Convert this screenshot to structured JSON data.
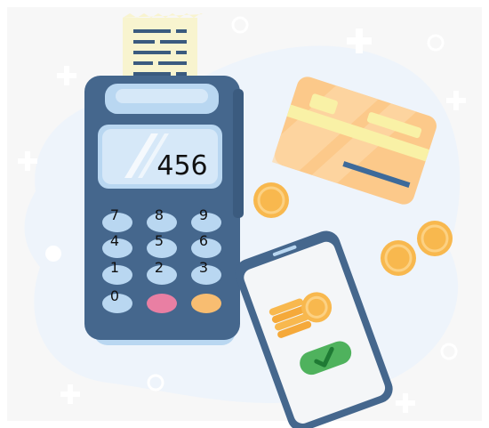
{
  "terminal": {
    "display_value": "456",
    "keys": [
      {
        "id": "7",
        "label": "7"
      },
      {
        "id": "8",
        "label": "8"
      },
      {
        "id": "9",
        "label": "9"
      },
      {
        "id": "4",
        "label": "4"
      },
      {
        "id": "5",
        "label": "5"
      },
      {
        "id": "6",
        "label": "6"
      },
      {
        "id": "1",
        "label": "1"
      },
      {
        "id": "2",
        "label": "2"
      },
      {
        "id": "3",
        "label": "3"
      },
      {
        "id": "0",
        "label": "0"
      }
    ],
    "colors": {
      "body": "#45678d",
      "body_dark": "#3b5b7f",
      "key": "#b9d7f1",
      "cancel_key": "#e97fa3",
      "enter_key": "#f8bd71",
      "screen": "#d6e8f8"
    }
  },
  "card": {
    "colors": {
      "face": "#fcc98a",
      "stripe": "#3d6a9a",
      "chip": "#f9f1a6"
    }
  },
  "phone": {
    "colors": {
      "body": "#45678d",
      "screen": "#f4f6f8",
      "confirm": "#4fb25d",
      "coin": "#f8b84e"
    }
  },
  "background": {
    "blob": "#eef4fb",
    "frame": "#f7f7f7"
  }
}
